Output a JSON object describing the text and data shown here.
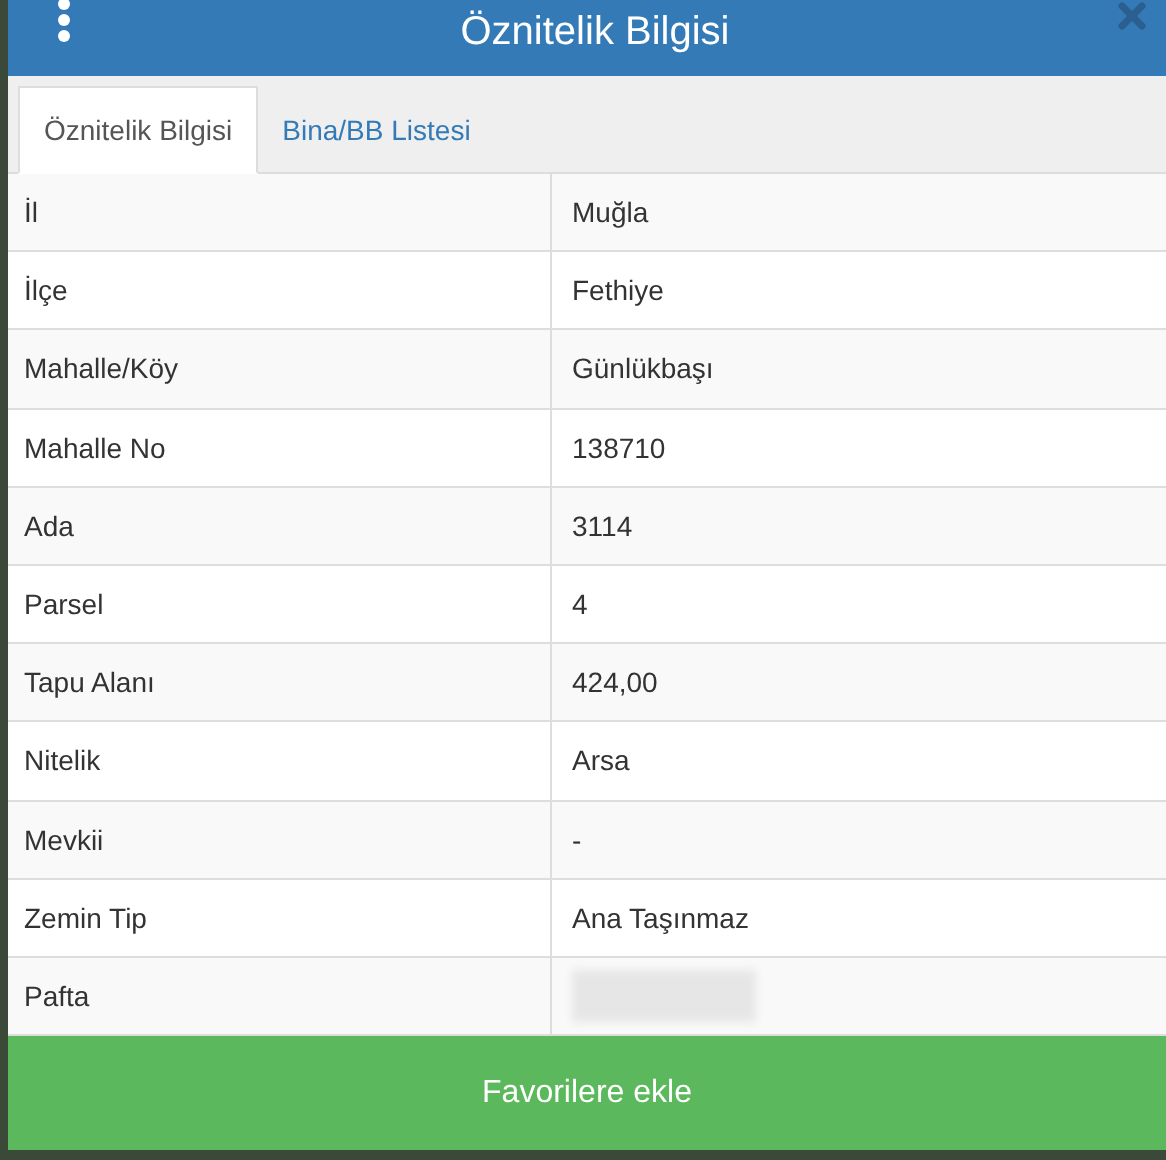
{
  "window": {
    "title": "Öznitelik Bilgisi"
  },
  "tabs": [
    {
      "label": "Öznitelik Bilgisi",
      "selected": true
    },
    {
      "label": "Bina/BB Listesi",
      "selected": false
    }
  ],
  "table": {
    "rows": [
      {
        "label": "İl",
        "value": "Muğla",
        "redacted": false
      },
      {
        "label": "İlçe",
        "value": "Fethiye",
        "redacted": false
      },
      {
        "label": "Mahalle/Köy",
        "value": "Günlükbaşı",
        "redacted": false
      },
      {
        "label": "Mahalle No",
        "value": "138710",
        "redacted": false
      },
      {
        "label": "Ada",
        "value": "3114",
        "redacted": false
      },
      {
        "label": "Parsel",
        "value": "4",
        "redacted": false
      },
      {
        "label": "Tapu Alanı",
        "value": "424,00",
        "redacted": false
      },
      {
        "label": "Nitelik",
        "value": "Arsa",
        "redacted": false
      },
      {
        "label": "Mevkii",
        "value": "-",
        "redacted": false
      },
      {
        "label": "Zemin Tip",
        "value": "Ana Taşınmaz",
        "redacted": false
      },
      {
        "label": "Pafta",
        "redacted": true
      }
    ]
  },
  "footer_button": "Favorilere ekle"
}
